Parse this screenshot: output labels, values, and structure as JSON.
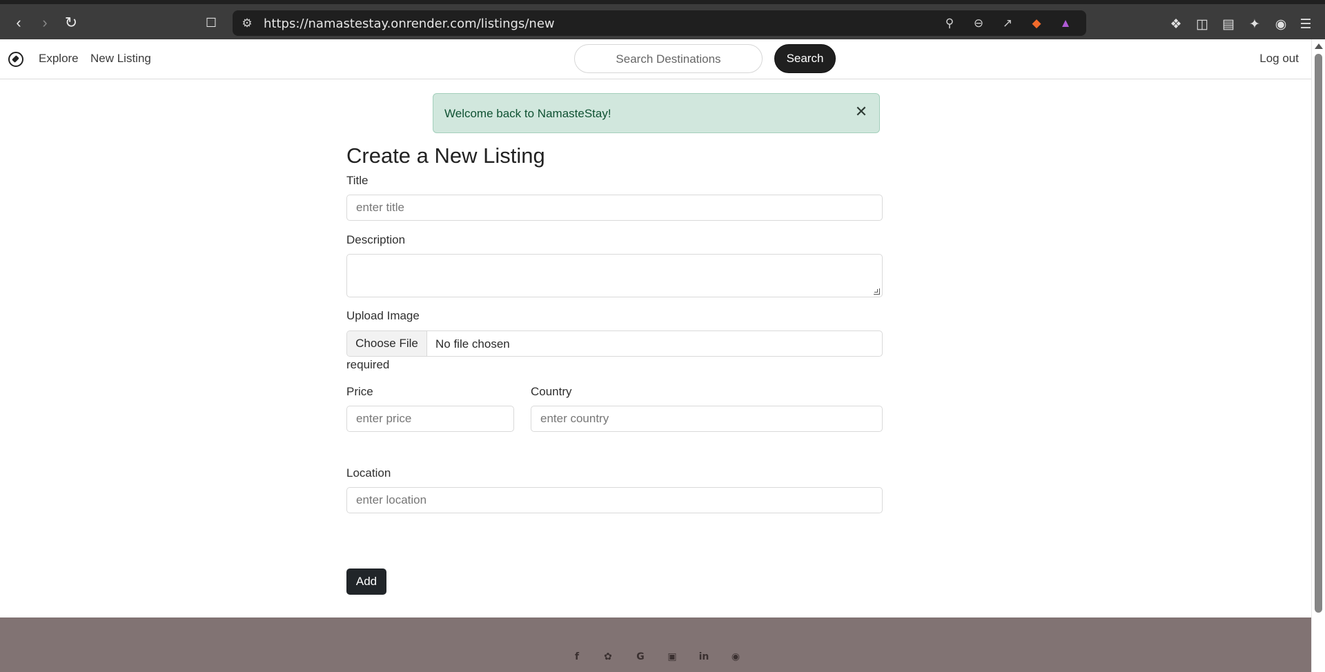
{
  "browser": {
    "url": "https://namastestay.onrender.com/listings/new",
    "back_icon": "chevron-left-icon",
    "forward_icon": "chevron-right-icon",
    "reload_icon": "reload-icon"
  },
  "navbar": {
    "explore_label": "Explore",
    "new_listing_label": "New Listing",
    "search_placeholder": "Search Destinations",
    "search_button_label": "Search",
    "logout_label": "Log out"
  },
  "alert": {
    "message": "Welcome back to NamasteStay!",
    "color": "#d1e7dd"
  },
  "form": {
    "heading": "Create a New Listing",
    "title_label": "Title",
    "title_placeholder": "enter title",
    "description_label": "Description",
    "description_value": "",
    "upload_label": "Upload Image",
    "choose_file_label": "Choose File",
    "file_status": "No file chosen",
    "required_text": "required",
    "price_label": "Price",
    "price_placeholder": "enter price",
    "country_label": "Country",
    "country_placeholder": "enter country",
    "location_label": "Location",
    "location_placeholder": "enter location",
    "submit_label": "Add"
  },
  "footer": {
    "background": "#817373",
    "social_icons": [
      "facebook-icon",
      "twitter-icon",
      "google-icon",
      "instagram-icon",
      "linkedin-icon",
      "github-icon"
    ]
  }
}
